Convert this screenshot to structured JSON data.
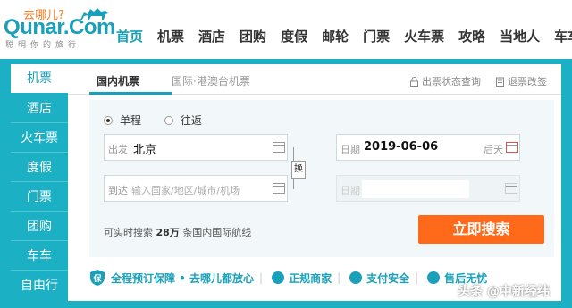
{
  "header": {
    "logo_top": "去哪儿?",
    "logo_main": "Qunar.Com",
    "logo_slogan": "聪明你的旅行",
    "nav": [
      {
        "label": "首页",
        "active": true
      },
      {
        "label": "机票"
      },
      {
        "label": "酒店"
      },
      {
        "label": "团购"
      },
      {
        "label": "度假"
      },
      {
        "label": "邮轮"
      },
      {
        "label": "门票"
      },
      {
        "label": "火车票"
      },
      {
        "label": "攻略"
      },
      {
        "label": "当地人"
      },
      {
        "label": "车车"
      }
    ]
  },
  "sidebar": {
    "items": [
      {
        "label": "机票",
        "active": true
      },
      {
        "label": "酒店"
      },
      {
        "label": "火车票"
      },
      {
        "label": "度假"
      },
      {
        "label": "门票"
      },
      {
        "label": "团购"
      },
      {
        "label": "车车"
      },
      {
        "label": "自由行"
      }
    ]
  },
  "tabs": {
    "domestic": "国内机票",
    "international": "国际·港澳台机票",
    "status_link": "出票状态查询",
    "refund_link": "退票改签"
  },
  "form": {
    "trip_oneway": "单程",
    "trip_round": "往返",
    "from_label": "出发",
    "from_value": "北京",
    "to_label": "到达",
    "to_placeholder": "输入国家/地区/城市/机场",
    "swap_label": "换",
    "date_label": "日期",
    "date_value": "2019-06-06",
    "date_extra": "后天",
    "return_date_label": "日期"
  },
  "info": {
    "prefix": "可实时搜索",
    "count": "28万",
    "suffix": "条国内国际航线"
  },
  "search_button": "立即搜索",
  "guarantee": {
    "main": "全程预订保障 • 去哪儿都放心",
    "merchant": "正规商家",
    "payment": "支付安全",
    "aftersale": "售后无忧"
  },
  "watermark": "头条 @中新经纬",
  "colors": {
    "brand": "#1aa0b8",
    "frame": "#1bb0c4",
    "search_button": "#ff6a1a",
    "logo_top": "#ff7a1a"
  }
}
